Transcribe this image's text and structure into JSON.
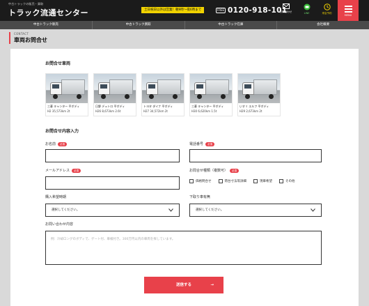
{
  "header": {
    "tagline": "中古トラックの販売・買取",
    "logo": "トラック流通センター",
    "notice": "土日祝日以外は営業！朝9時〜夜6時まで",
    "phone_badge": "FREE",
    "phone": "0120-918-101",
    "icons": [
      {
        "name": "mail-icon",
        "label": "お問合わせ"
      },
      {
        "name": "line-icon",
        "label": "LINE"
      },
      {
        "name": "reserve-icon",
        "label": "来店予約"
      }
    ],
    "menu_label": "MENU"
  },
  "nav": [
    "中古トラック販売",
    "中古トラック買取",
    "中古トラック在庫",
    "会社概要"
  ],
  "page": {
    "subtitle": "CONTACT",
    "title": "車両お問合せ"
  },
  "vehicles_section": "お問合せ車両",
  "vehicles": [
    {
      "name": "三菱 キャンター 平ボディ",
      "year": "H2",
      "km": "35,573km",
      "price": "2t"
    },
    {
      "name": "日野 デュトロ 平ボディ",
      "year": "H26",
      "km": "8,673km",
      "price": "2.6t"
    },
    {
      "name": "トヨタ ダイナ 平ボディ",
      "year": "H27",
      "km": "34,572km",
      "price": "2t"
    },
    {
      "name": "三菱 キャンター 平ボディ",
      "year": "H30",
      "km": "6,620km",
      "price": "1.5t"
    },
    {
      "name": "いすゞ エルフ 平ボディ",
      "year": "H29",
      "km": "2,673km",
      "price": "2t"
    }
  ],
  "form_section": "お問合せ内容入力",
  "form": {
    "required": "必須",
    "name_label": "お名前",
    "phone_label": "電話番号",
    "email_label": "メールアドレス",
    "type_label": "お問合せ種類（複数可）",
    "type_options": [
      "価格問合せ",
      "荷台寸法等詳細",
      "現車希望",
      "その他"
    ],
    "purchase_label": "購入希望時期",
    "purchase_value": "選択してください。",
    "trade_label": "下取り車有無",
    "trade_value": "選択してください。",
    "message_label": "お問い合わせ内容",
    "message_placeholder": "例：冷却ロングのボディで、ゲート付、車検付き。300万円以内の車両を探しています。",
    "submit": "送信する"
  }
}
